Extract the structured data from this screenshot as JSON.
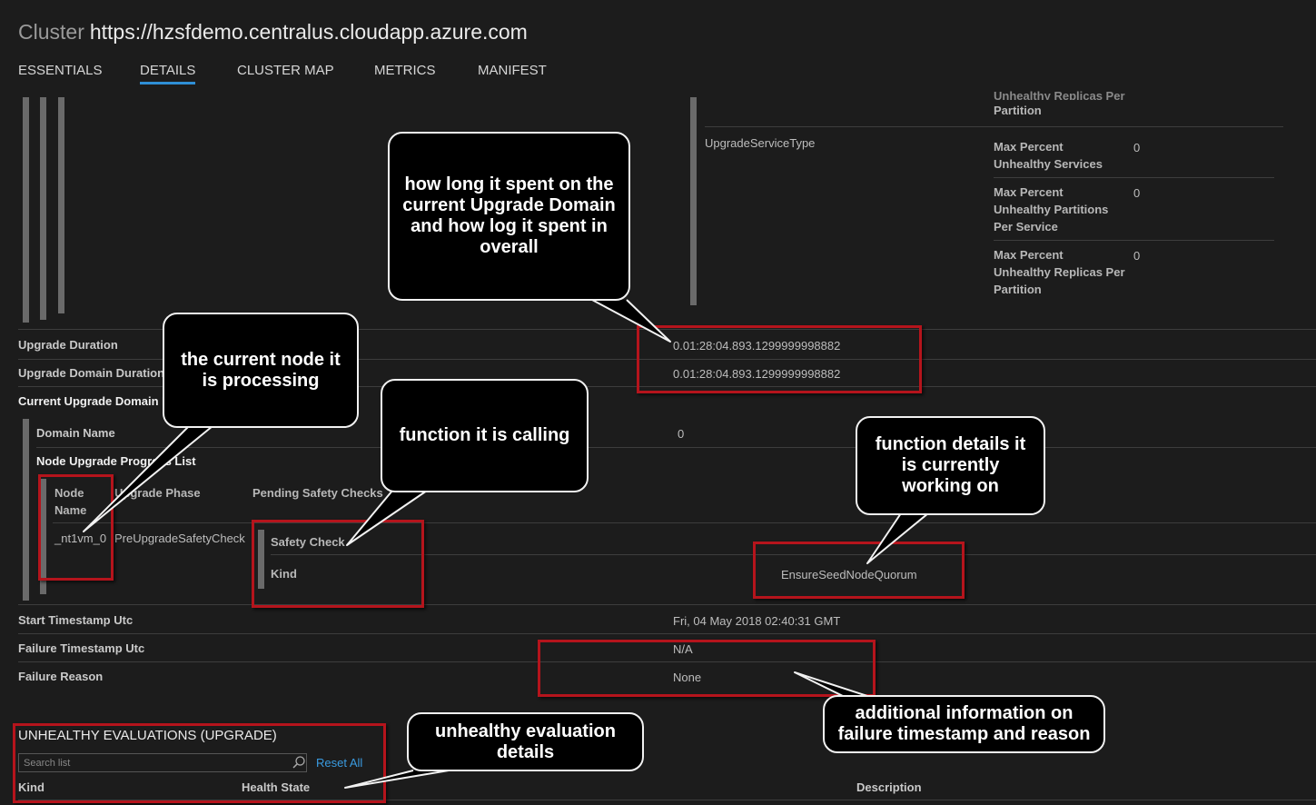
{
  "header": {
    "prefix": "Cluster",
    "url": "https://hzsfdemo.centralus.cloudapp.azure.com"
  },
  "tabs": [
    {
      "label": "ESSENTIALS"
    },
    {
      "label": "DETAILS",
      "active": true
    },
    {
      "label": "CLUSTER MAP"
    },
    {
      "label": "METRICS"
    },
    {
      "label": "MANIFEST"
    }
  ],
  "policy": {
    "top_partial_label_1": "Unhealthy Replicas Per",
    "top_partial_label_2": "Partition",
    "service_type": "UpgradeServiceType",
    "rows": [
      {
        "label_1": "Max Percent",
        "label_2": "Unhealthy Services",
        "label_3": "",
        "value": "0"
      },
      {
        "label_1": "Max Percent",
        "label_2": "Unhealthy Partitions",
        "label_3": "Per Service",
        "value": "0"
      },
      {
        "label_1": "Max Percent",
        "label_2": "Unhealthy Replicas Per",
        "label_3": "Partition",
        "value": "0"
      }
    ]
  },
  "details": {
    "upgrade_duration": {
      "label": "Upgrade Duration",
      "value": "0.01:28:04.893.1299999998882"
    },
    "domain_duration": {
      "label": "Upgrade Domain Duration",
      "value": "0.01:28:04.893.1299999998882"
    },
    "current_progress_label": "Current Upgrade Domain Progress",
    "domain_name": {
      "label": "Domain Name",
      "value": "0"
    },
    "node_list_label": "Node Upgrade Progress List",
    "node_table": {
      "col_node_1": "Node",
      "col_node_2": "Name",
      "col_phase": "Upgrade Phase",
      "col_checks": "Pending Safety Checks",
      "node_name": "_nt1vm_0",
      "phase": "PreUpgradeSafetyCheck",
      "safety_check_label": "Safety Check",
      "kind_label": "Kind",
      "kind_value": "EnsureSeedNodeQuorum"
    },
    "start_timestamp": {
      "label": "Start Timestamp Utc",
      "value": "Fri, 04 May 2018 02:40:31 GMT"
    },
    "failure_timestamp": {
      "label": "Failure Timestamp Utc",
      "value": "N/A"
    },
    "failure_reason": {
      "label": "Failure Reason",
      "value": "None"
    }
  },
  "unhealthy": {
    "title": "UNHEALTHY EVALUATIONS (UPGRADE)",
    "search_placeholder": "Search list",
    "reset_label": "Reset All",
    "columns": [
      "Kind",
      "Health State",
      "Description"
    ]
  },
  "callouts": {
    "duration": "how long it spent on the current Upgrade Domain and how log it spent in overall",
    "node": "the current node it is processing",
    "function": "function it is calling",
    "function_details": "function details it is currently working on",
    "failure": "additional information on failure timestamp and reason",
    "unhealthy": "unhealthy evaluation details"
  },
  "colors": {
    "accent": "#2f8fd6",
    "callout_border": "#b5141c",
    "background": "#1c1c1c"
  }
}
